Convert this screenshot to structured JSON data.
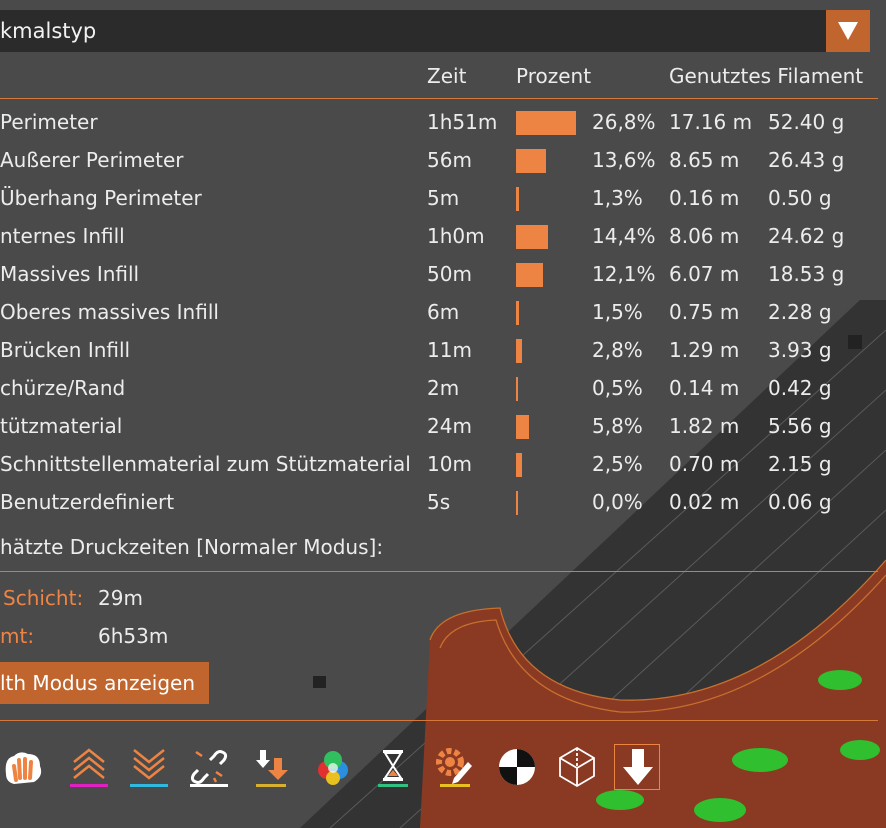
{
  "combo": {
    "label": "kmalstyp",
    "arrow_icon": "triangle-down-icon"
  },
  "table": {
    "columns": {
      "time": "Zeit",
      "percent": "Prozent",
      "filament": "Genutztes Filament"
    },
    "rows": [
      {
        "name": "Perimeter",
        "time": "1h51m",
        "fraction": 0.268,
        "percent": "26,8%",
        "length": "17.16 m",
        "weight": "52.40 g"
      },
      {
        "name": "Außerer Perimeter",
        "time": "56m",
        "fraction": 0.136,
        "percent": "13,6%",
        "length": "8.65 m",
        "weight": "26.43 g"
      },
      {
        "name": "Überhang Perimeter",
        "time": "5m",
        "fraction": 0.013,
        "percent": "1,3%",
        "length": "0.16 m",
        "weight": "0.50 g"
      },
      {
        "name": "nternes Infill",
        "time": "1h0m",
        "fraction": 0.144,
        "percent": "14,4%",
        "length": "8.06 m",
        "weight": "24.62 g"
      },
      {
        "name": "Massives Infill",
        "time": "50m",
        "fraction": 0.121,
        "percent": "12,1%",
        "length": "6.07 m",
        "weight": "18.53 g"
      },
      {
        "name": "Oberes massives Infill",
        "time": "6m",
        "fraction": 0.015,
        "percent": "1,5%",
        "length": "0.75 m",
        "weight": "2.28 g"
      },
      {
        "name": "Brücken Infill",
        "time": "11m",
        "fraction": 0.028,
        "percent": "2,8%",
        "length": "1.29 m",
        "weight": "3.93 g"
      },
      {
        "name": "chürze/Rand",
        "time": "2m",
        "fraction": 0.005,
        "percent": "0,5%",
        "length": "0.14 m",
        "weight": "0.42 g"
      },
      {
        "name": "tützmaterial",
        "time": "24m",
        "fraction": 0.058,
        "percent": "5,8%",
        "length": "1.82 m",
        "weight": "5.56 g"
      },
      {
        "name": "Schnittstellenmaterial zum Stützmaterial",
        "time": "10m",
        "fraction": 0.025,
        "percent": "2,5%",
        "length": "0.70 m",
        "weight": "2.15 g"
      },
      {
        "name": "Benutzerdefiniert",
        "time": "5s",
        "fraction": 0.0,
        "percent": "0,0%",
        "length": "0.02 m",
        "weight": "0.06 g"
      }
    ]
  },
  "estimates": {
    "title": "hätzte Druckzeiten [Normaler Modus]:",
    "first_layer_label": "Schicht:",
    "first_layer_value": "29m",
    "total_label": "mt:",
    "total_value": "6h53m"
  },
  "mode_button": {
    "label": "lth Modus anzeigen"
  },
  "toolbar": {
    "icons": [
      "hand-icon",
      "chevrons-up-icon",
      "chevrons-down-icon",
      "unlink-icon",
      "download-arrow-icon",
      "color-circles-icon",
      "hourglass-icon",
      "gear-pencil-icon",
      "balance-marker-icon",
      "wireframe-cube-icon",
      "down-arrow-icon"
    ]
  },
  "colors": {
    "accent": "#c0652d",
    "bar": "#ee8444",
    "panel": "#4a4a4a",
    "combo": "#2b2b2b"
  }
}
